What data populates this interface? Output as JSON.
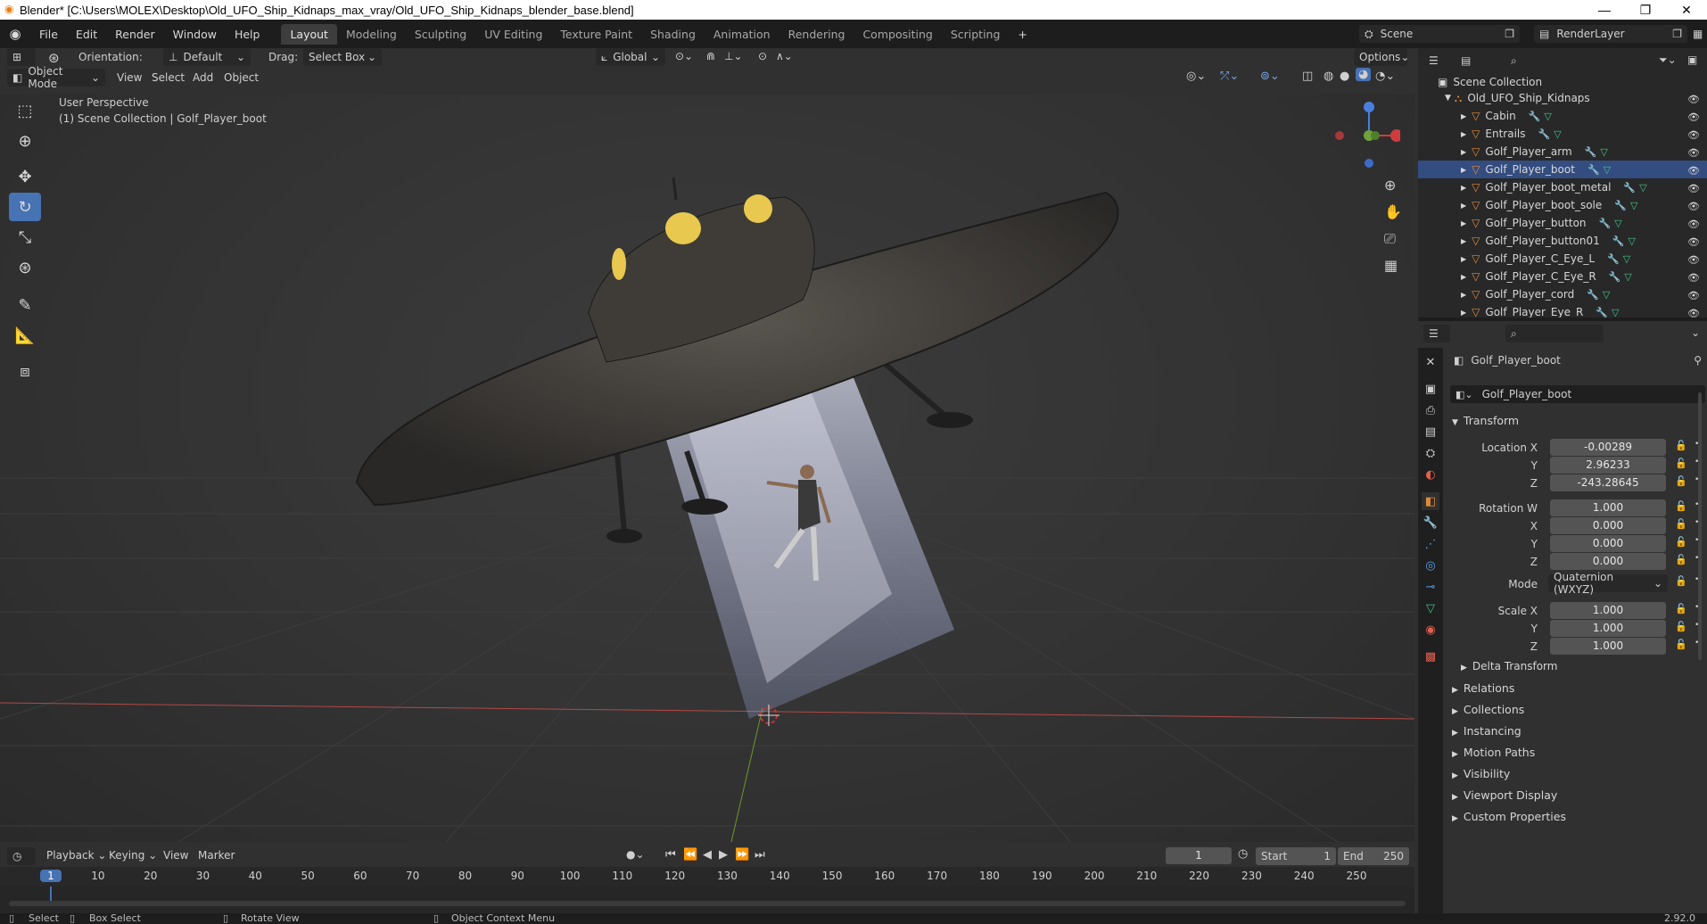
{
  "window": {
    "title": "Blender* [C:\\Users\\MOLEX\\Desktop\\Old_UFO_Ship_Kidnaps_max_vray/Old_UFO_Ship_Kidnaps_blender_base.blend]"
  },
  "menu": [
    "File",
    "Edit",
    "Render",
    "Window",
    "Help"
  ],
  "workspaces": [
    "Layout",
    "Modeling",
    "Sculpting",
    "UV Editing",
    "Texture Paint",
    "Shading",
    "Animation",
    "Rendering",
    "Compositing",
    "Scripting"
  ],
  "scene": {
    "name": "Scene",
    "render_layer": "RenderLayer"
  },
  "viewport_header": {
    "orientation_label": "Orientation:",
    "orientation_value": "Default",
    "drag_label": "Drag:",
    "drag_value": "Select Box",
    "transform_orientation": "Global",
    "options": "Options",
    "mode": "Object Mode",
    "menus": [
      "View",
      "Select",
      "Add",
      "Object"
    ]
  },
  "viewport": {
    "perspective": "User Perspective",
    "collection_info": "(1) Scene Collection | Golf_Player_boot"
  },
  "outliner": {
    "root": "Scene Collection",
    "collection": "Old_UFO_Ship_Kidnaps",
    "items": [
      "Cabin",
      "Entrails",
      "Golf_Player_arm",
      "Golf_Player_boot",
      "Golf_Player_boot_metal",
      "Golf_Player_boot_sole",
      "Golf_Player_button",
      "Golf_Player_button01",
      "Golf_Player_C_Eye_L",
      "Golf_Player_C_Eye_R",
      "Golf_Player_cord",
      "Golf_Player_Eye_R"
    ]
  },
  "properties": {
    "object_name": "Golf_Player_boot",
    "data_name": "Golf_Player_boot",
    "transform_label": "Transform",
    "location": {
      "label": "Location X",
      "x": "-0.00289",
      "y": "2.96233",
      "z": "-243.28645"
    },
    "rotation": {
      "label": "Rotation W",
      "w": "1.000",
      "x": "0.000",
      "y": "0.000",
      "z": "0.000"
    },
    "mode_label": "Mode",
    "mode_value": "Quaternion (WXYZ)",
    "scale": {
      "label": "Scale X",
      "x": "1.000",
      "y": "1.000",
      "z": "1.000"
    },
    "axis_y": "Y",
    "axis_z": "Z",
    "axis_x": "X",
    "delta": "Delta Transform",
    "sections": [
      "Relations",
      "Collections",
      "Instancing",
      "Motion Paths",
      "Visibility",
      "Viewport Display",
      "Custom Properties"
    ]
  },
  "timeline": {
    "menus": [
      "Playback",
      "Keying",
      "View",
      "Marker"
    ],
    "current_frame": "1",
    "start_label": "Start",
    "start": "1",
    "end_label": "End",
    "end": "250",
    "ticks": [
      "1",
      "10",
      "20",
      "30",
      "40",
      "50",
      "60",
      "70",
      "80",
      "90",
      "100",
      "110",
      "120",
      "130",
      "140",
      "150",
      "160",
      "170",
      "180",
      "190",
      "200",
      "210",
      "220",
      "230",
      "240",
      "250"
    ]
  },
  "status": {
    "select": "Select",
    "box_select": "Box Select",
    "rotate_view": "Rotate View",
    "context_menu": "Object Context Menu",
    "version": "2.92.0"
  },
  "colors": {
    "accent": "#4772b3",
    "selected_row": "#334d80",
    "mesh_orange": "#e08a3c"
  }
}
